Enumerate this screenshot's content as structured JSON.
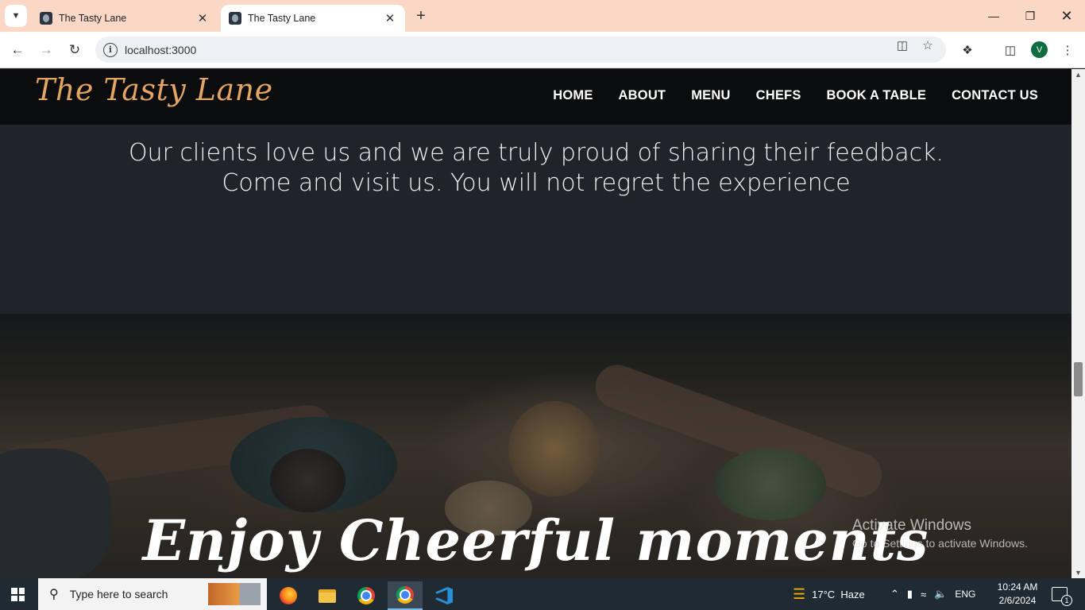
{
  "browser": {
    "tabs": [
      {
        "title": "The Tasty Lane",
        "active": false
      },
      {
        "title": "The Tasty Lane",
        "active": true
      }
    ],
    "address": "localhost:3000",
    "profile_initial": "V"
  },
  "site": {
    "logo": "The Tasty Lane",
    "nav": [
      "HOME",
      "ABOUT",
      "MENU",
      "CHEFS",
      "BOOK A TABLE",
      "CONTACT US"
    ],
    "feedback_text": "Our clients love us and we are truly proud of sharing their feedback. Come and visit us. You will not regret the experience",
    "hero_heading": "Enjoy Cheerful moments"
  },
  "watermark": {
    "title": "Activate Windows",
    "subtitle": "Go to Settings to activate Windows."
  },
  "taskbar": {
    "search_placeholder": "Type here to search",
    "weather": "17°C  Haze",
    "language": "ENG",
    "time": "10:24 AM",
    "date": "2/6/2024",
    "notification_count": "1"
  }
}
